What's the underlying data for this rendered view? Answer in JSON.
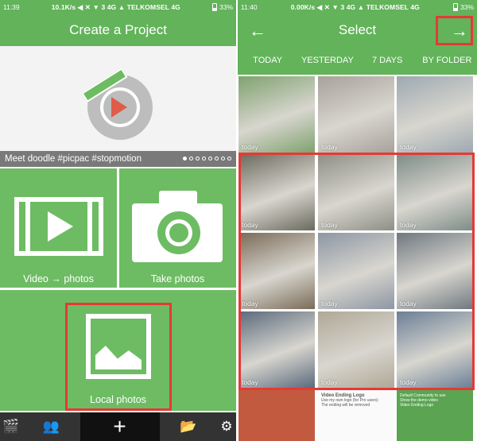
{
  "left_screen": {
    "status": {
      "time": "11:39",
      "speed": "10.1K/s",
      "signal": "3 4G",
      "carrier": "TELKOMSEL 4G",
      "battery": "33%"
    },
    "title": "Create a Project",
    "banner_caption": "Meet doodle  #picpac #stopmotion",
    "tiles": {
      "video": "Video → photos",
      "take": "Take photos",
      "local": "Local photos"
    },
    "nav": {
      "add": "+"
    }
  },
  "right_screen": {
    "status": {
      "time": "11:40",
      "speed": "0.00K/s",
      "signal": "3 4G",
      "carrier": "TELKOMSEL 4G",
      "battery": "33%"
    },
    "title": "Select",
    "back_glyph": "←",
    "forward_glyph": "→",
    "tabs": [
      "TODAY",
      "YESTERDAY",
      "7 DAYS",
      "BY FOLDER"
    ],
    "thumb_label": "today",
    "thumb_colors": [
      "#7fa26f",
      "#a7a29a",
      "#9da9b0",
      "#6b6a5e",
      "#8f8f86",
      "#7e8c88",
      "#7a6b58",
      "#8d96a3",
      "#6f7880",
      "#5b6a7c",
      "#b0a897",
      "#6b7f96"
    ],
    "settings_preview": {
      "left_title": "Video Ending Logo",
      "left_opt1": "Use my own logo (for Pro users)",
      "left_opt2": "The ending will be removed",
      "right_title": "Default Community to use",
      "right_opt": "Show the demo video",
      "right_opt2": "Video Ending Logo"
    }
  },
  "colors": {
    "primary": "#62b35a",
    "tile": "#6dbc63",
    "highlight": "#e53935",
    "nav": "#333333"
  }
}
